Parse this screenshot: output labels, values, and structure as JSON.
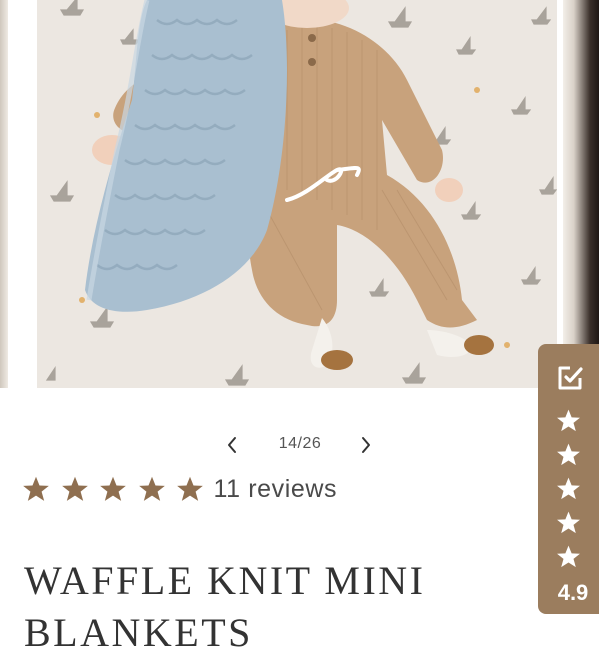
{
  "pager": {
    "counter": "14/26"
  },
  "rating": {
    "stars": 5,
    "reviews_label": "11 reviews"
  },
  "product": {
    "title": "WAFFLE KNIT MINI BLANKETS"
  },
  "widget": {
    "score": "4.9",
    "stars": 5
  },
  "colors": {
    "accent": "#9b7d5e",
    "star": "#8f6f50",
    "photo_bg": "#ece7e1",
    "blanket": "#a9bfd0",
    "romper": "#c8a27c"
  },
  "icons": {
    "prev": "chevron-left-icon",
    "next": "chevron-right-icon",
    "star": "star-icon",
    "widget": "review-check-icon"
  }
}
